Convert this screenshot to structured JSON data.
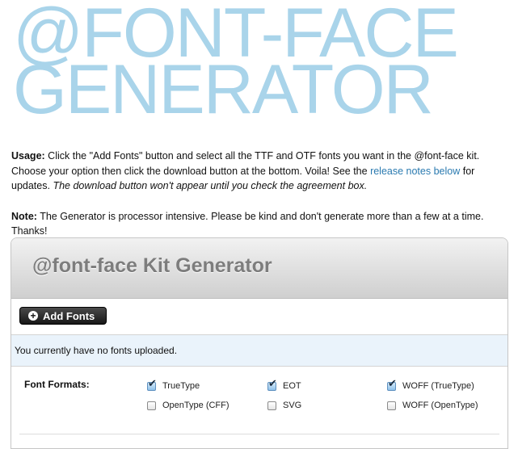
{
  "hero": {
    "line1": "@FONT-FACE",
    "line2": "GENERATOR"
  },
  "usage": {
    "label": "Usage:",
    "text1": "Click the \"Add Fonts\" button and select all the TTF and OTF fonts you want in the @font-face kit. Choose your option then click the download button at the bottom. Voila! See the",
    "link": "release notes below",
    "text2": "for updates.",
    "italic": "The download button won't appear until you check the agreement box."
  },
  "note": {
    "label": "Note:",
    "text": "The Generator is processor intensive. Please be kind and don't generate more than a few at a time. Thanks!"
  },
  "panel": {
    "title": "@font-face Kit Generator",
    "add_button": "Add Fonts",
    "status": "You currently have no fonts uploaded.",
    "formats_label": "Font Formats:",
    "formats": [
      {
        "label": "TrueType",
        "checked": true
      },
      {
        "label": "EOT",
        "checked": true
      },
      {
        "label": "WOFF (TrueType)",
        "checked": true
      },
      {
        "label": "OpenType (CFF)",
        "checked": false
      },
      {
        "label": "SVG",
        "checked": false
      },
      {
        "label": "WOFF (OpenType)",
        "checked": false
      }
    ]
  },
  "colors": {
    "hero": "#a9d4ea",
    "link": "#2a7ab0",
    "status_bg": "#eaf3fb"
  }
}
